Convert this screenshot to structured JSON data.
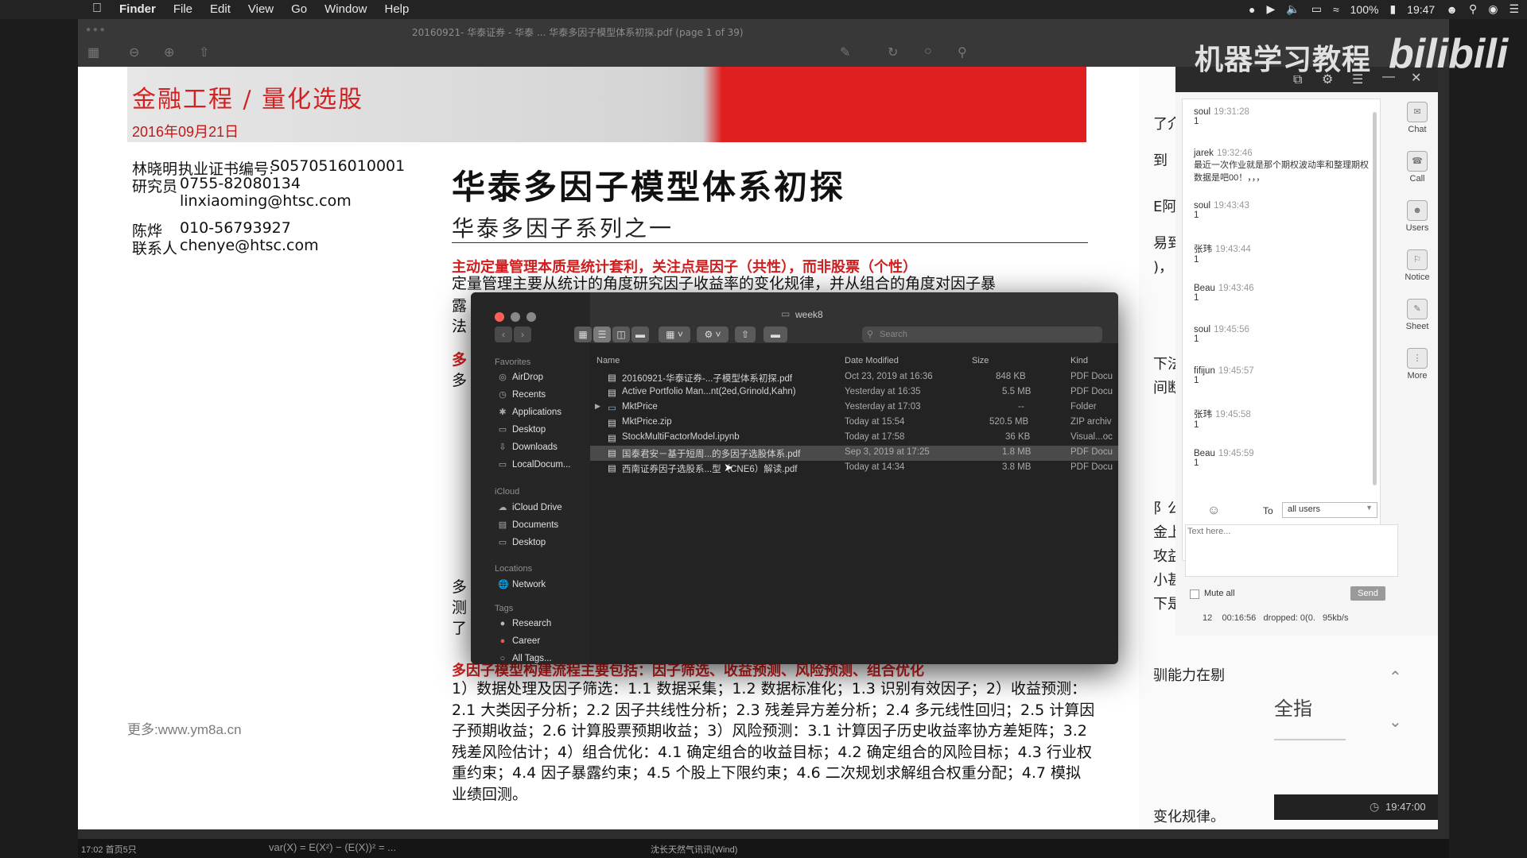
{
  "menubar": {
    "app": "Finder",
    "items": [
      "File",
      "Edit",
      "View",
      "Go",
      "Window",
      "Help"
    ],
    "battery": "100%",
    "clock": "19:47"
  },
  "preview": {
    "title": "20160921- 华泰证券 - 华泰 ... 华泰多因子模型体系初探.pdf (page 1 of 39)",
    "status_left": "17:02 首页5只",
    "formula": "var(X) = E(X²) − (E(X))² = ...",
    "status_right": "沈长天然气讯讯(Wind)"
  },
  "doc": {
    "banner_title": "金融工程 / 量化选股",
    "banner_date": "2016年09月21日",
    "author1_name": "林晓明",
    "author1_role": "研究员",
    "author1_cert_label": "执业证书编号:",
    "author1_cert": "S0570516010001",
    "author1_phone": "0755-82080134",
    "author1_email": "linxiaoming@htsc.com",
    "author2_name": "陈烨",
    "author2_role": "联系人",
    "author2_phone": "010-56793927",
    "author2_email": "chenye@htsc.com",
    "main_title": "华泰多因子模型体系初探",
    "sub_title": "华泰多因子系列之一",
    "lead_red": "主动定量管理本质是统计套利，关注点是因子（共性），而非股票（个性）",
    "lead_body": "定量管理主要从统计的角度研究因子收益率的变化规律，并从组合的角度对因子暴",
    "frag1": "露",
    "frag2": "法",
    "frag3": "多",
    "frag4": "多",
    "frag5": "多",
    "frag6": "测",
    "frag7": "了",
    "red_section": "多因子模型构建流程主要包括：因子筛选、收益预测、风险预测、组合优化",
    "body_para": "1）数据处理及因子筛选：1.1 数据采集；1.2 数据标准化；1.3 识别有效因子；2）收益预测：2.1 大类因子分析；2.2 因子共线性分析；2.3 残差异方差分析；2.4 多元线性回归；2.5 计算因子预期收益；2.6 计算股票预期收益；3）风险预测：3.1 计算因子历史收益率协方差矩阵；3.2 残差风险估计；4）组合优化：4.1 确定组合的收益目标；4.2 确定组合的风险目标；4.3 行业权重约束；4.4 因子暴露约束；4.5 个股上下限约束；4.6 二次规划求解组合权重分配；4.7 模拟业绩回测。",
    "more_link": "更多:www.ym8a.cn"
  },
  "page2": {
    "lines": [
      "了介",
      "到",
      "E阿",
      "易到",
      ")，",
      "下法",
      "间断",
      "阝公",
      "金上",
      "攻益",
      "小甚",
      "下是",
      "驯能力在剔",
      "全指",
      "变化规律。"
    ]
  },
  "finder": {
    "title": "week8",
    "search_placeholder": "Search",
    "sidebar": {
      "favorites_label": "Favorites",
      "favorites": [
        "AirDrop",
        "Recents",
        "Applications",
        "Desktop",
        "Downloads",
        "LocalDocum..."
      ],
      "icloud_label": "iCloud",
      "icloud": [
        "iCloud Drive",
        "Documents",
        "Desktop"
      ],
      "locations_label": "Locations",
      "locations": [
        "Network"
      ],
      "tags_label": "Tags",
      "tags": [
        "Research",
        "Career",
        "All Tags..."
      ]
    },
    "columns": [
      "Name",
      "Date Modified",
      "Size",
      "Kind"
    ],
    "files": [
      {
        "name": "20160921-华泰证券-...子模型体系初探.pdf",
        "date": "Oct 23, 2019 at 16:36",
        "size": "848 KB",
        "kind": "PDF Docu"
      },
      {
        "name": "Active Portfolio Man...nt(2ed,Grinold,Kahn)",
        "date": "Yesterday at 16:35",
        "size": "5.5 MB",
        "kind": "PDF Docu"
      },
      {
        "name": "MktPrice",
        "date": "Yesterday at 17:03",
        "size": "--",
        "kind": "Folder"
      },
      {
        "name": "MktPrice.zip",
        "date": "Today at 15:54",
        "size": "520.5 MB",
        "kind": "ZIP archiv"
      },
      {
        "name": "StockMultiFactorModel.ipynb",
        "date": "Today at 17:58",
        "size": "36 KB",
        "kind": "Visual...oc"
      },
      {
        "name": "国泰君安－基于短周...的多因子选股体系.pdf",
        "date": "Sep 3, 2019 at 17:25",
        "size": "1.8 MB",
        "kind": "PDF Docu"
      },
      {
        "name": "西南证券因子选股系...型（CNE6）解读.pdf",
        "date": "Today at 14:34",
        "size": "3.8 MB",
        "kind": "PDF Docu"
      }
    ]
  },
  "chat": {
    "watermark": "机器学习教程",
    "logo": "bilibili",
    "messages": [
      {
        "name": "soul",
        "time": "19:31:28",
        "text": "1"
      },
      {
        "name": "jarek",
        "time": "19:32:46",
        "text": "最近一次作业就是那个期权波动率和整理期权数据是吧00！，，，"
      },
      {
        "name": "soul",
        "time": "19:43:43",
        "text": "1"
      },
      {
        "name": "张玮",
        "time": "19:43:44",
        "text": "1"
      },
      {
        "name": "Beau",
        "time": "19:43:46",
        "text": "1"
      },
      {
        "name": "soul",
        "time": "19:45:56",
        "text": "1"
      },
      {
        "name": "fifijun",
        "time": "19:45:57",
        "text": "1"
      },
      {
        "name": "张玮",
        "time": "19:45:58",
        "text": "1"
      },
      {
        "name": "Beau",
        "time": "19:45:59",
        "text": "1"
      }
    ],
    "side_buttons": [
      "Chat",
      "Call",
      "Users",
      "Notice",
      "Sheet",
      "More"
    ],
    "to_label": "To",
    "to_value": "all users",
    "input_placeholder": "Text here...",
    "mute_label": "Mute all",
    "send_label": "Send",
    "stats": "12    00:16:56   dropped: 0(0.   95kb/s",
    "bottom_time": "19:47:00"
  }
}
